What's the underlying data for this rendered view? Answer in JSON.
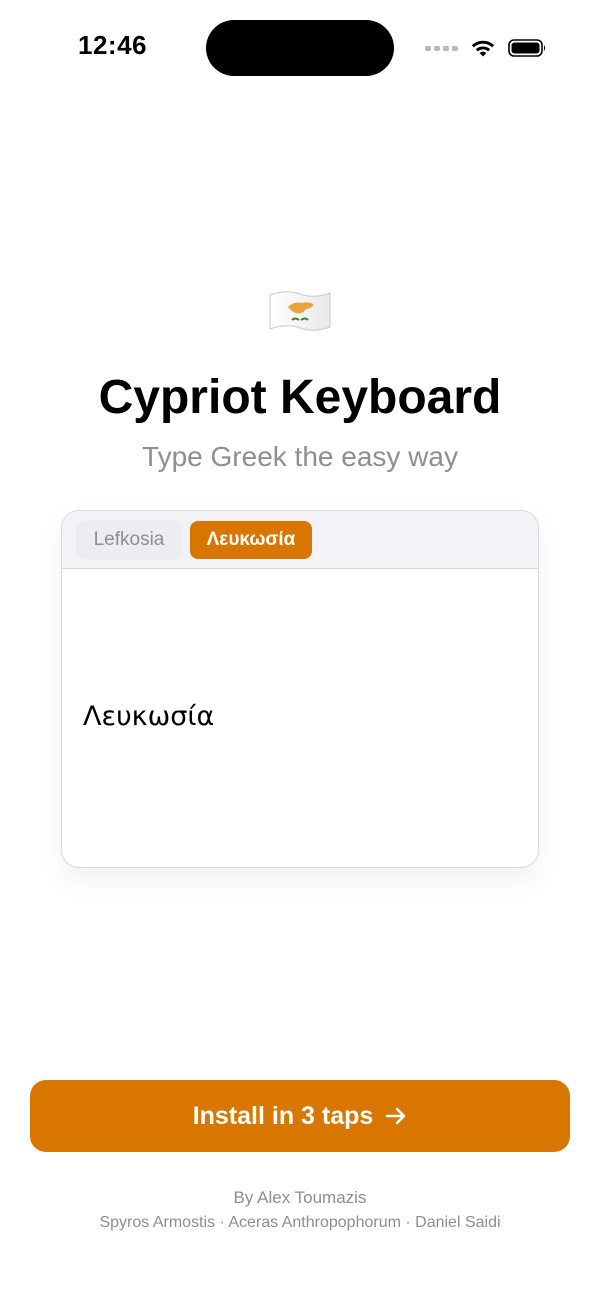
{
  "status_bar": {
    "time": "12:46",
    "icons": [
      "cellular-signal-icon",
      "wifi-icon",
      "battery-icon"
    ]
  },
  "header": {
    "flag_icon": "cyprus-flag-icon",
    "title": "Cypriot Keyboard",
    "subtitle": "Type Greek the easy way"
  },
  "demo": {
    "tabs": [
      {
        "label": "Lefkosia",
        "selected": false
      },
      {
        "label": "Λευκωσία",
        "selected": true
      }
    ],
    "text": "Λευκωσία"
  },
  "install_button": {
    "label": "Install in 3 taps",
    "icon": "arrow-right-icon"
  },
  "footer": {
    "author": "By Alex Toumazis",
    "credits": "Spyros Armostis · Aceras Anthropophorum · Daniel Saidi"
  },
  "colors": {
    "accent": "#d87600",
    "secondary_text": "#8e8e93",
    "tab_bar_background": "#f2f2f7",
    "flag_white": "#ffffff",
    "flag_copper": "#e8a33d",
    "flag_olive": "#4a7a2a"
  }
}
